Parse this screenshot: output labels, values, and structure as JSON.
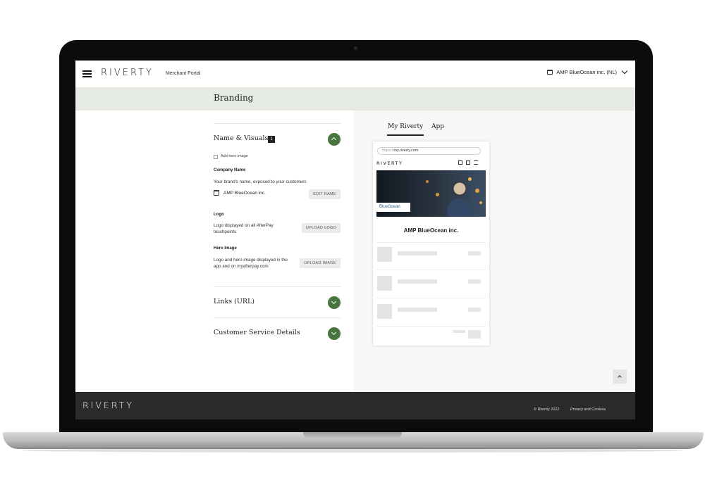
{
  "header": {
    "logo": "RIVERTY",
    "portal_label": "Merchant Portal",
    "merchant_name": "AMP BlueOcean inc. (NL)"
  },
  "page_title": "Branding",
  "sections": {
    "name_visuals": {
      "title": "Name & Visuals",
      "badge": "1",
      "checkbox_label": "Add hero image",
      "company_name_label": "Company Name",
      "company_name_desc": "Your brand's name, exposed to your customers",
      "company_name_value": "AMP BlueOcean inc.",
      "edit_name_button": "EDIT NAME",
      "logo_label": "Logo",
      "logo_desc_1": "Logo displayed on all AfterPay",
      "logo_desc_2": "touchpoints",
      "upload_logo_button": "UPLOAD LOGO",
      "hero_label": "Hero Image",
      "hero_desc_1": "Logo and hero image displayed in the",
      "hero_desc_2": "app and on myafterpay.com",
      "upload_image_button": "UPLOAD IMAGE"
    },
    "links": {
      "title": "Links (URL)"
    },
    "customer_service": {
      "title": "Customer Service Details"
    }
  },
  "preview": {
    "tabs": [
      "My Riverty",
      "App"
    ],
    "active_tab": "My Riverty",
    "url_prefix": "https://",
    "url": "my.riverty.com",
    "mobile_logo": "RIVERTY",
    "hero_logo": "BlueOcean",
    "company_name": "AMP BlueOcean inc."
  },
  "footer": {
    "logo": "RIVERTY",
    "copyright": "© Riverty 2022",
    "privacy_link": "Privacy and Cookies"
  },
  "colors": {
    "accent_green": "#48753d",
    "title_band": "#e5ebe2",
    "footer_bg": "#2b2b2b"
  },
  "icons": [
    "menu-icon",
    "store-icon",
    "chevron-down-icon",
    "chevron-up-icon",
    "back-to-top-icon"
  ]
}
